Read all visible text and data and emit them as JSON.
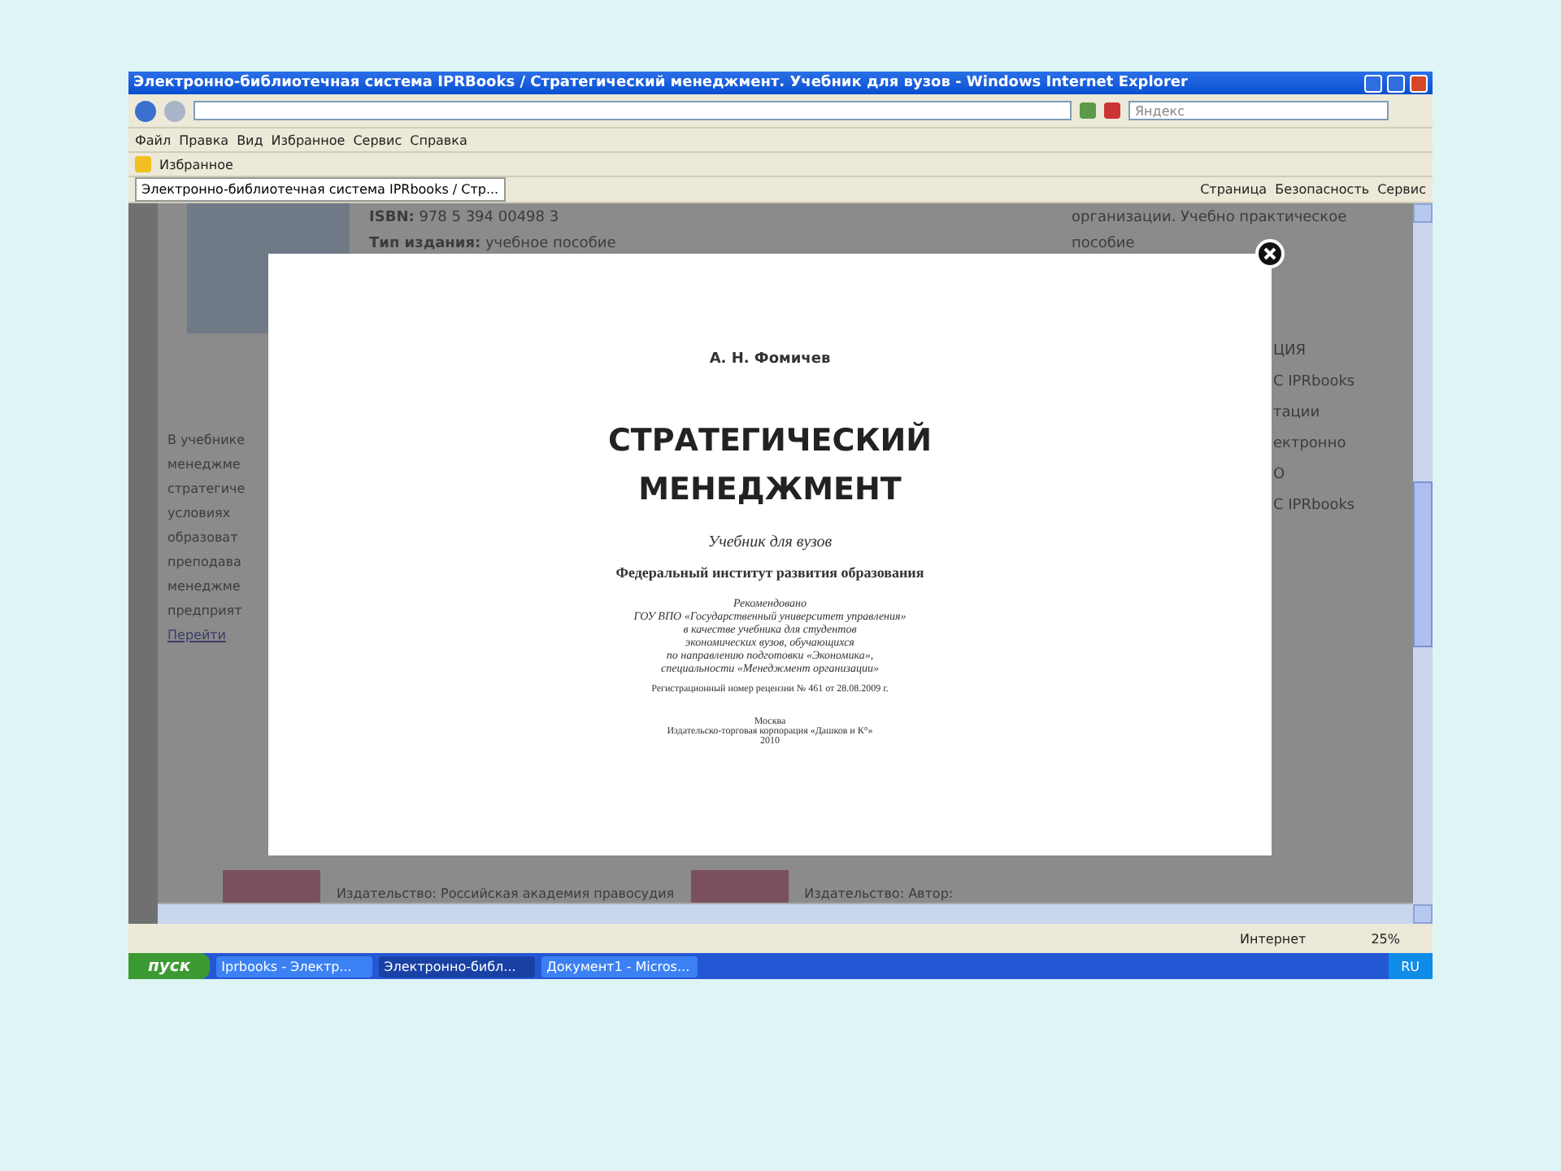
{
  "window": {
    "title": "Электронно-библиотечная система IPRBooks / Стратегический менеджмент. Учебник для вузов - Windows Internet Explorer"
  },
  "search": {
    "placeholder": "Яндекс"
  },
  "menu": [
    "Файл",
    "Правка",
    "Вид",
    "Избранное",
    "Сервис",
    "Справка"
  ],
  "favorites_bar": {
    "label": "Избранное"
  },
  "tab": {
    "title": "Электронно-библиотечная система IPRbooks / Стр..."
  },
  "command_bar": [
    "Страница",
    "Безопасность",
    "Сервис"
  ],
  "page": {
    "isbn_label": "ISBN:",
    "isbn": "978 5 394 00498 3",
    "type_label": "Тип издания:",
    "type": "учебное пособие",
    "left_fragments": [
      "В учебнике",
      "менеджме",
      "стратегиче",
      "условиях",
      "образоват",
      "преподава",
      "менеджме",
      "предприят"
    ],
    "more_link": "Перейти",
    "right_top": [
      "организации. Учебно практическое",
      "пособие"
    ],
    "right_fragments": [
      "ЦИЯ",
      "С IPRbooks",
      "тации",
      "ектронно",
      "О",
      "С IPRbooks"
    ],
    "bottom": [
      {
        "label": "Издательство:",
        "value": "Российская академия правосудия"
      },
      {
        "label": "Издательство:",
        "value": "Автор:"
      }
    ]
  },
  "modal": {
    "author": "А. Н. Фомичев",
    "title_lines": [
      "СТРАТЕГИЧЕСКИЙ",
      "МЕНЕДЖМЕНТ"
    ],
    "subtitle": "Учебник для вузов",
    "institute": "Федеральный институт развития образования",
    "recommendation": [
      "Рекомендовано",
      "ГОУ ВПО «Государственный университет управления»",
      "в качестве учебника для студентов",
      "экономических вузов, обучающихся",
      "по направлению подготовки «Экономика»,",
      "специальности «Менеджмент организации»"
    ],
    "registration": "Регистрационный номер рецензии № 461 от 28.08.2009 г.",
    "city": "Москва",
    "publisher": "Издательско-торговая корпорация «Дашков и К°»",
    "year": "2010"
  },
  "status_bar": {
    "zone": "Интернет",
    "zoom": "25%"
  },
  "taskbar": {
    "start": "пуск",
    "items": [
      {
        "label": "Iprbooks - Электр...",
        "selected": false
      },
      {
        "label": "Электронно-библ...",
        "selected": true
      },
      {
        "label": "Документ1 - Micros...",
        "selected": false
      }
    ],
    "language": "RU"
  }
}
